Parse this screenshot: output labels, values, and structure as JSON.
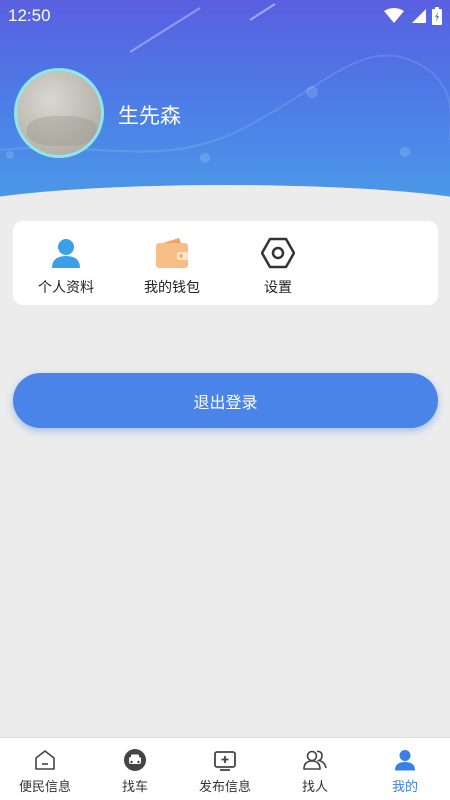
{
  "status_bar": {
    "time": "12:50"
  },
  "profile": {
    "name": "生先森"
  },
  "menu": {
    "items": [
      {
        "label": "个人资料",
        "icon": "user-icon"
      },
      {
        "label": "我的钱包",
        "icon": "wallet-icon"
      },
      {
        "label": "设置",
        "icon": "settings-icon"
      }
    ]
  },
  "logout": {
    "label": "退出登录"
  },
  "tabbar": {
    "items": [
      {
        "label": "便民信息",
        "icon": "home-icon"
      },
      {
        "label": "找车",
        "icon": "car-icon"
      },
      {
        "label": "发布信息",
        "icon": "publish-icon"
      },
      {
        "label": "找人",
        "icon": "people-icon"
      },
      {
        "label": "我的",
        "icon": "user-icon",
        "active": true
      }
    ]
  },
  "colors": {
    "accent": "#4a84e8",
    "header_top": "#5a5fe0",
    "header_bottom": "#4b9ae8",
    "avatar_ring": "#8ee7ea",
    "wallet": "#f7be87",
    "active_tab": "#3a7fe6"
  }
}
